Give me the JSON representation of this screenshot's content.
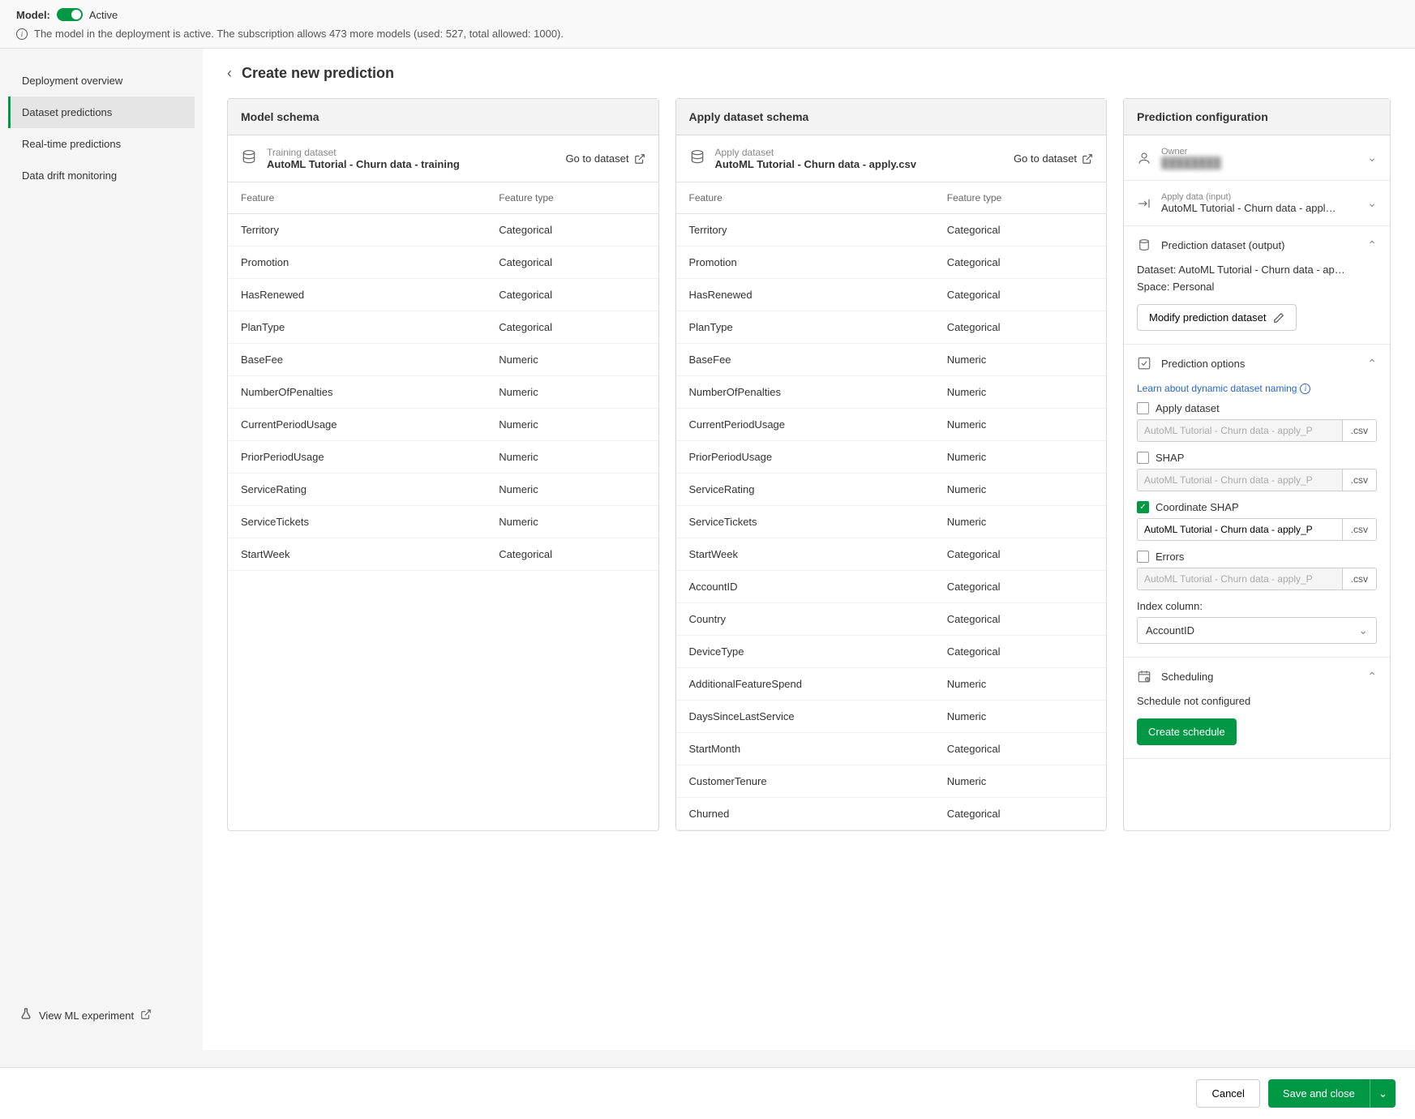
{
  "topbar": {
    "model_label": "Model:",
    "status": "Active",
    "info_text": "The model in the deployment is active. The subscription allows 473 more models (used: 527, total allowed: 1000)."
  },
  "sidebar": {
    "items": [
      {
        "label": "Deployment overview",
        "active": false
      },
      {
        "label": "Dataset predictions",
        "active": true
      },
      {
        "label": "Real-time predictions",
        "active": false
      },
      {
        "label": "Data drift monitoring",
        "active": false
      }
    ],
    "bottom_link": "View ML experiment"
  },
  "page": {
    "title": "Create new prediction"
  },
  "model_schema": {
    "title": "Model schema",
    "dataset_caption": "Training dataset",
    "dataset_name": "AutoML Tutorial - Churn data - training",
    "goto": "Go to dataset",
    "headers": {
      "feature": "Feature",
      "type": "Feature type"
    },
    "rows": [
      {
        "feature": "Territory",
        "type": "Categorical"
      },
      {
        "feature": "Promotion",
        "type": "Categorical"
      },
      {
        "feature": "HasRenewed",
        "type": "Categorical"
      },
      {
        "feature": "PlanType",
        "type": "Categorical"
      },
      {
        "feature": "BaseFee",
        "type": "Numeric"
      },
      {
        "feature": "NumberOfPenalties",
        "type": "Numeric"
      },
      {
        "feature": "CurrentPeriodUsage",
        "type": "Numeric"
      },
      {
        "feature": "PriorPeriodUsage",
        "type": "Numeric"
      },
      {
        "feature": "ServiceRating",
        "type": "Numeric"
      },
      {
        "feature": "ServiceTickets",
        "type": "Numeric"
      },
      {
        "feature": "StartWeek",
        "type": "Categorical"
      }
    ]
  },
  "apply_schema": {
    "title": "Apply dataset schema",
    "dataset_caption": "Apply dataset",
    "dataset_name": "AutoML Tutorial - Churn data - apply.csv",
    "goto": "Go to dataset",
    "headers": {
      "feature": "Feature",
      "type": "Feature type"
    },
    "rows": [
      {
        "feature": "Territory",
        "type": "Categorical"
      },
      {
        "feature": "Promotion",
        "type": "Categorical"
      },
      {
        "feature": "HasRenewed",
        "type": "Categorical"
      },
      {
        "feature": "PlanType",
        "type": "Categorical"
      },
      {
        "feature": "BaseFee",
        "type": "Numeric"
      },
      {
        "feature": "NumberOfPenalties",
        "type": "Numeric"
      },
      {
        "feature": "CurrentPeriodUsage",
        "type": "Numeric"
      },
      {
        "feature": "PriorPeriodUsage",
        "type": "Numeric"
      },
      {
        "feature": "ServiceRating",
        "type": "Numeric"
      },
      {
        "feature": "ServiceTickets",
        "type": "Numeric"
      },
      {
        "feature": "StartWeek",
        "type": "Categorical"
      },
      {
        "feature": "AccountID",
        "type": "Categorical"
      },
      {
        "feature": "Country",
        "type": "Categorical"
      },
      {
        "feature": "DeviceType",
        "type": "Categorical"
      },
      {
        "feature": "AdditionalFeatureSpend",
        "type": "Numeric"
      },
      {
        "feature": "DaysSinceLastService",
        "type": "Numeric"
      },
      {
        "feature": "StartMonth",
        "type": "Categorical"
      },
      {
        "feature": "CustomerTenure",
        "type": "Numeric"
      },
      {
        "feature": "Churned",
        "type": "Categorical"
      }
    ]
  },
  "config": {
    "title": "Prediction configuration",
    "owner": {
      "caption": "Owner",
      "value": "████████"
    },
    "apply_data": {
      "caption": "Apply data (input)",
      "value": "AutoML Tutorial - Churn data - appl…"
    },
    "output": {
      "title": "Prediction dataset (output)",
      "dataset_line": "Dataset: AutoML Tutorial - Churn data - ap…",
      "space_line": "Space: Personal",
      "modify_btn": "Modify prediction dataset"
    },
    "options": {
      "title": "Prediction options",
      "learn_link": "Learn about dynamic dataset naming",
      "items": [
        {
          "label": "Apply dataset",
          "value": "AutoML Tutorial - Churn data - apply_P",
          "ext": ".csv",
          "checked": false
        },
        {
          "label": "SHAP",
          "value": "AutoML Tutorial - Churn data - apply_P",
          "ext": ".csv",
          "checked": false
        },
        {
          "label": "Coordinate SHAP",
          "value": "AutoML Tutorial - Churn data - apply_P",
          "ext": ".csv",
          "checked": true
        },
        {
          "label": "Errors",
          "value": "AutoML Tutorial - Churn data - apply_P",
          "ext": ".csv",
          "checked": false
        }
      ],
      "index_label": "Index column:",
      "index_value": "AccountID"
    },
    "scheduling": {
      "title": "Scheduling",
      "status": "Schedule not configured",
      "btn": "Create schedule"
    }
  },
  "footer": {
    "cancel": "Cancel",
    "save": "Save and close"
  }
}
